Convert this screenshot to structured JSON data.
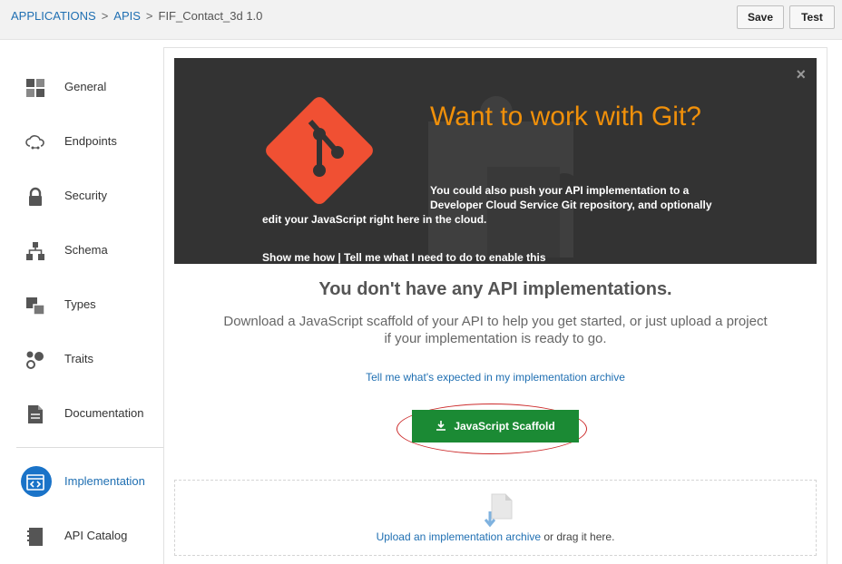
{
  "breadcrumb": {
    "applications": "APPLICATIONS",
    "sep1": ">",
    "apis": "APIS",
    "sep2": ">",
    "current": "FIF_Contact_3d  1.0"
  },
  "toolbar": {
    "save_label": "Save",
    "test_label": "Test"
  },
  "sidebar": {
    "items": [
      {
        "label": "General",
        "icon": "grid-icon"
      },
      {
        "label": "Endpoints",
        "icon": "cloud-link-icon"
      },
      {
        "label": "Security",
        "icon": "lock-icon"
      },
      {
        "label": "Schema",
        "icon": "hierarchy-icon"
      },
      {
        "label": "Types",
        "icon": "types-icon"
      },
      {
        "label": "Traits",
        "icon": "traits-icon"
      },
      {
        "label": "Documentation",
        "icon": "document-icon"
      },
      {
        "label": "Implementation",
        "icon": "code-icon"
      },
      {
        "label": "API Catalog",
        "icon": "catalog-icon"
      }
    ],
    "active_item": "Implementation"
  },
  "banner": {
    "close": "×",
    "title": "Want to work with Git?",
    "desc_line1": "You could also push your API implementation to a",
    "desc_line2": "Developer Cloud Service Git repository, and optionally",
    "desc_line3": "edit your JavaScript right here in the cloud.",
    "link_show": "Show me how",
    "link_sep": " | ",
    "link_tell": "Tell me what I need to do to enable this",
    "accent_color": "#f0900a",
    "git_color": "#f05033"
  },
  "empty_state": {
    "title": "You don't have any API implementations.",
    "description": "Download a JavaScript scaffold of your API to help you get started, or just upload a project if your implementation is ready to go.",
    "expected_link": "Tell me what's expected in my implementation archive",
    "scaffold_button": "JavaScript Scaffold",
    "scaffold_icon": "download-icon",
    "button_color": "#1b8a34"
  },
  "dropzone": {
    "upload_link": "Upload an implementation archive",
    "drag_text": " or drag it here."
  }
}
